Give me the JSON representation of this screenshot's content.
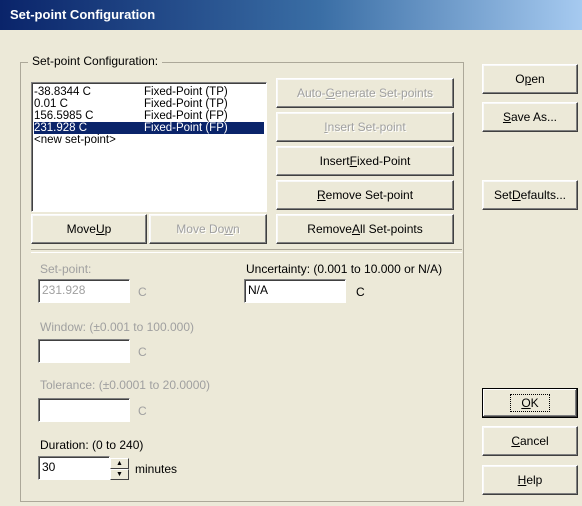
{
  "window": {
    "title": "Set-point Configuration"
  },
  "group": {
    "label": "Set-point Configuration:"
  },
  "setpoints": [
    {
      "value": "-38.8344 C",
      "type": "Fixed-Point (TP)",
      "selected": false
    },
    {
      "value": "0.01 C",
      "type": "Fixed-Point (TP)",
      "selected": false
    },
    {
      "value": "156.5985 C",
      "type": "Fixed-Point (FP)",
      "selected": false
    },
    {
      "value": "231.928 C",
      "type": "Fixed-Point (FP)",
      "selected": true
    },
    {
      "value": "<new set-point>",
      "type": "",
      "selected": false
    }
  ],
  "buttons": {
    "auto_generate": {
      "pre": "Auto-",
      "key": "G",
      "post": "enerate Set-points"
    },
    "insert_setpoint": {
      "pre": "",
      "key": "I",
      "post": "nsert Set-point"
    },
    "insert_fixed": {
      "pre": "Insert ",
      "key": "F",
      "post": "ixed-Point"
    },
    "remove_setpoint": {
      "pre": "",
      "key": "R",
      "post": "emove Set-point"
    },
    "remove_all": {
      "pre": "Remove ",
      "key": "A",
      "post": "ll Set-points"
    },
    "move_up": {
      "pre": "Move ",
      "key": "U",
      "post": "p"
    },
    "move_down": {
      "pre": "Move Do",
      "key": "w",
      "post": "n"
    },
    "open": {
      "pre": "O",
      "key": "p",
      "post": "en"
    },
    "save_as": {
      "pre": "",
      "key": "S",
      "post": "ave As..."
    },
    "set_defaults": {
      "pre": "Set ",
      "key": "D",
      "post": "efaults..."
    },
    "ok": {
      "pre": "",
      "key": "O",
      "post": "K"
    },
    "cancel": {
      "pre": "",
      "key": "C",
      "post": "ancel"
    },
    "help": {
      "pre": "",
      "key": "H",
      "post": "elp"
    }
  },
  "form": {
    "setpoint_label": "Set-point:",
    "setpoint_value": "231.928",
    "setpoint_unit": "C",
    "uncertainty_label": "Uncertainty: (0.001 to 10.000 or N/A)",
    "uncertainty_value": "N/A",
    "uncertainty_unit": "C",
    "window_label": "Window: (±0.001 to 100.000)",
    "window_value": "",
    "window_unit": "C",
    "tolerance_label": "Tolerance: (±0.0001 to 20.0000)",
    "tolerance_value": "",
    "tolerance_unit": "C",
    "duration_label": "Duration: (0 to 240)",
    "duration_value": "30",
    "duration_unit": "minutes"
  },
  "colors": {
    "selection": "#0a246a",
    "face": "#ece9d8",
    "disabled_text": "#a0a0a0"
  }
}
